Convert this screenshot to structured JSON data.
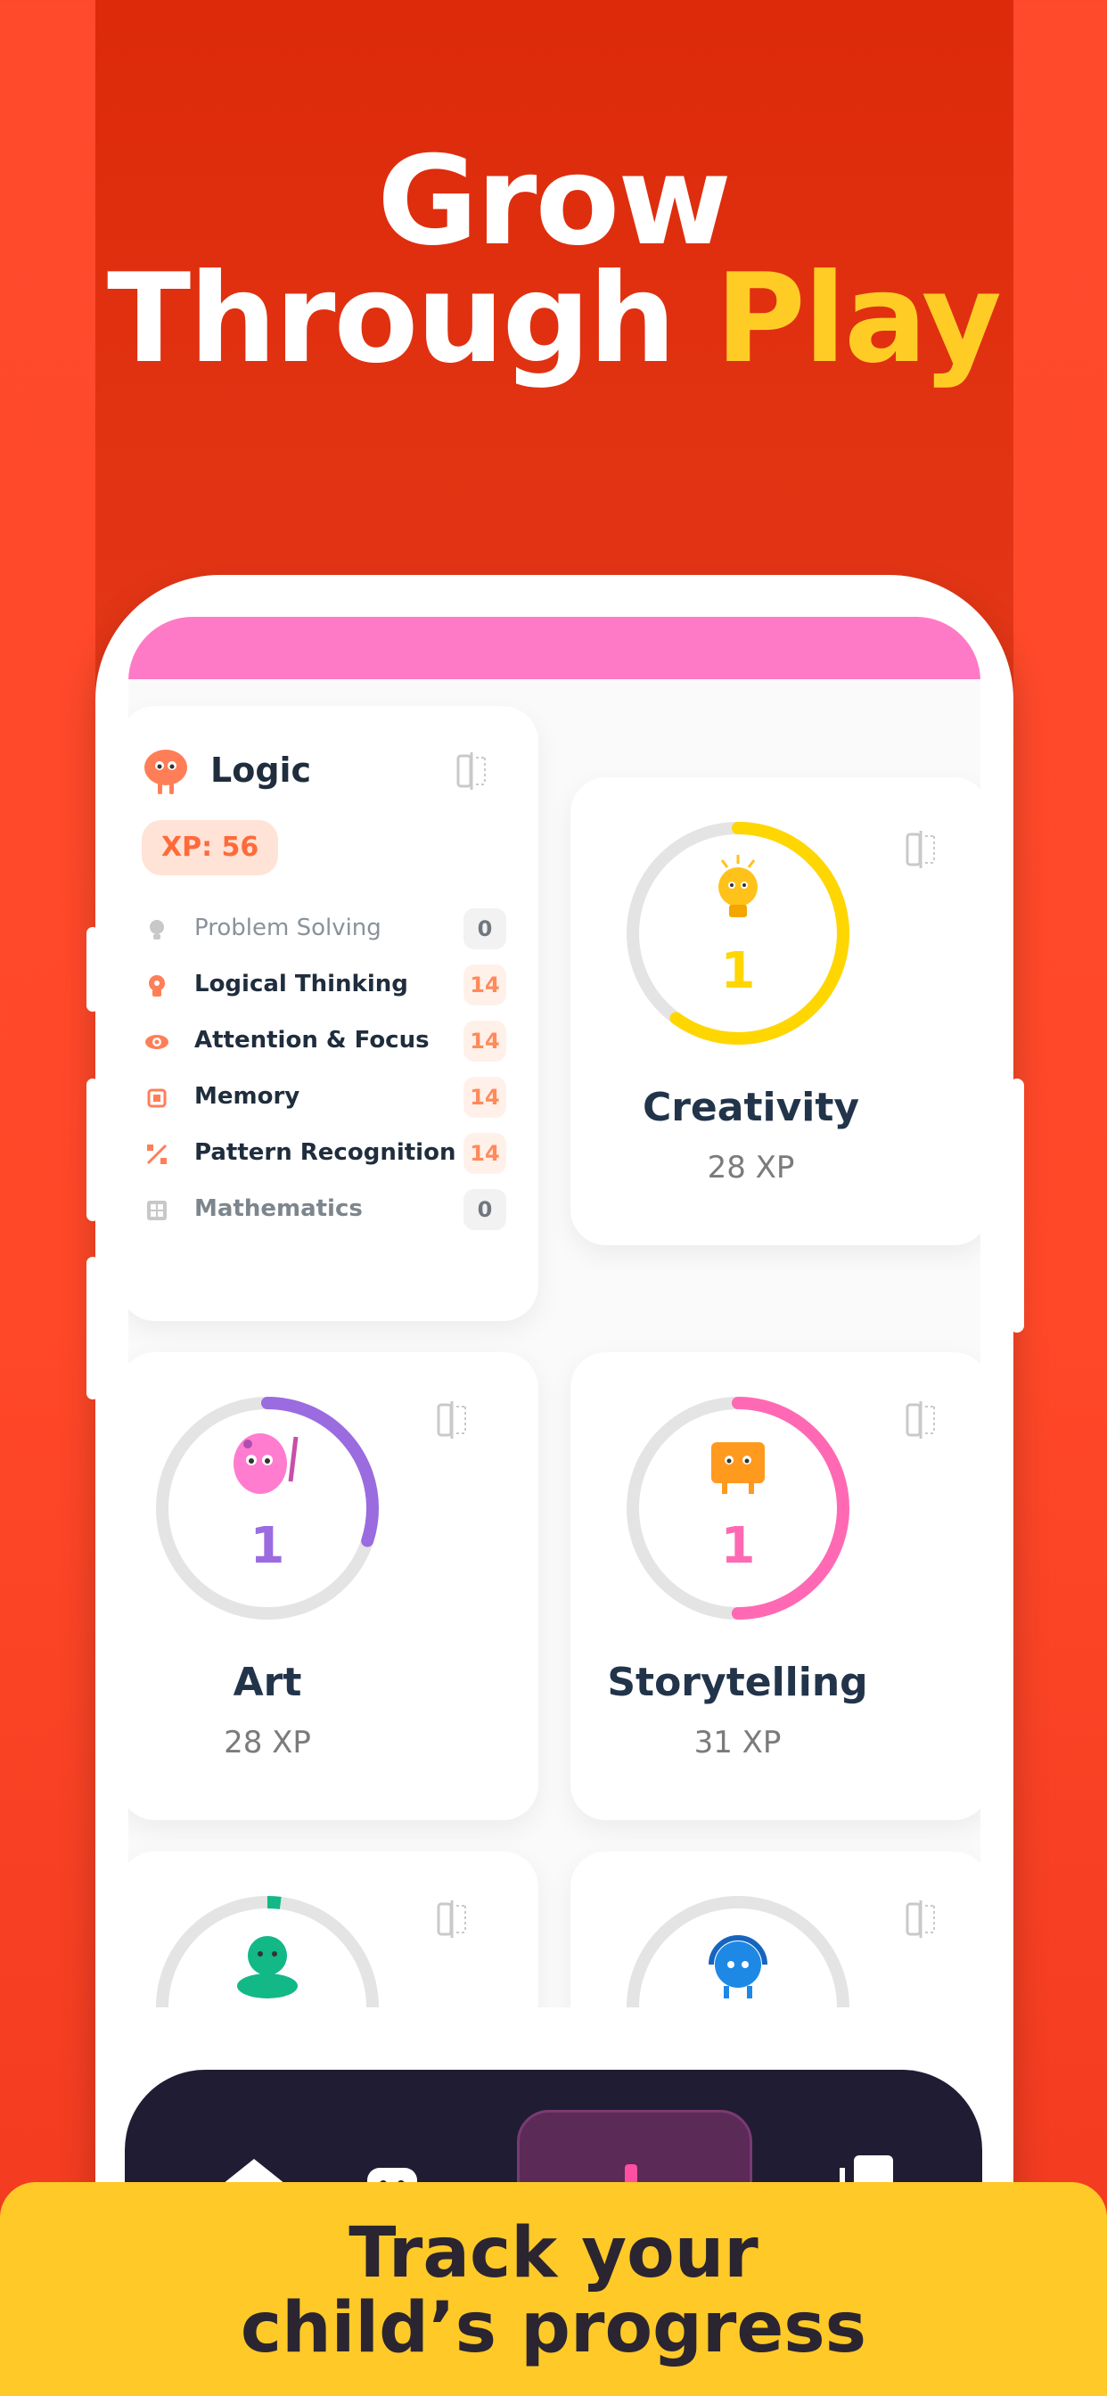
{
  "headline": {
    "line1": "Grow",
    "line2_white": "Through",
    "line2_accent": "Play"
  },
  "logic_card": {
    "title": "Logic",
    "xp": "XP: 56",
    "skills": [
      {
        "label": "Problem Solving",
        "count": "0"
      },
      {
        "label": "Logical Thinking",
        "count": "14"
      },
      {
        "label": "Attention & Focus",
        "count": "14"
      },
      {
        "label": "Memory",
        "count": "14"
      },
      {
        "label": "Pattern Recognition",
        "count": "14"
      },
      {
        "label": "Mathematics",
        "count": "0"
      }
    ]
  },
  "cards": [
    {
      "name": "Creativity",
      "level": "1",
      "xp": "28 XP",
      "color": "#ffd600",
      "progress": 0.6
    },
    {
      "name": "Art",
      "level": "1",
      "xp": "28 XP",
      "color": "#9b6be0",
      "progress": 0.3
    },
    {
      "name": "Storytelling",
      "level": "1",
      "xp": "31 XP",
      "color": "#ff69b4",
      "progress": 0.5
    }
  ],
  "partial_cards": [
    {
      "color": "#12b886",
      "progress": 0.02
    },
    {
      "color": "#1e88e5",
      "progress": 0.0
    }
  ],
  "banner": {
    "line1": "Track your",
    "line2": "child’s progress"
  },
  "colors": {
    "background": "#ff4a2c",
    "accent_yellow": "#ffcc26",
    "pink_bar": "#ff7ac6",
    "nav_dark": "#201c33"
  }
}
